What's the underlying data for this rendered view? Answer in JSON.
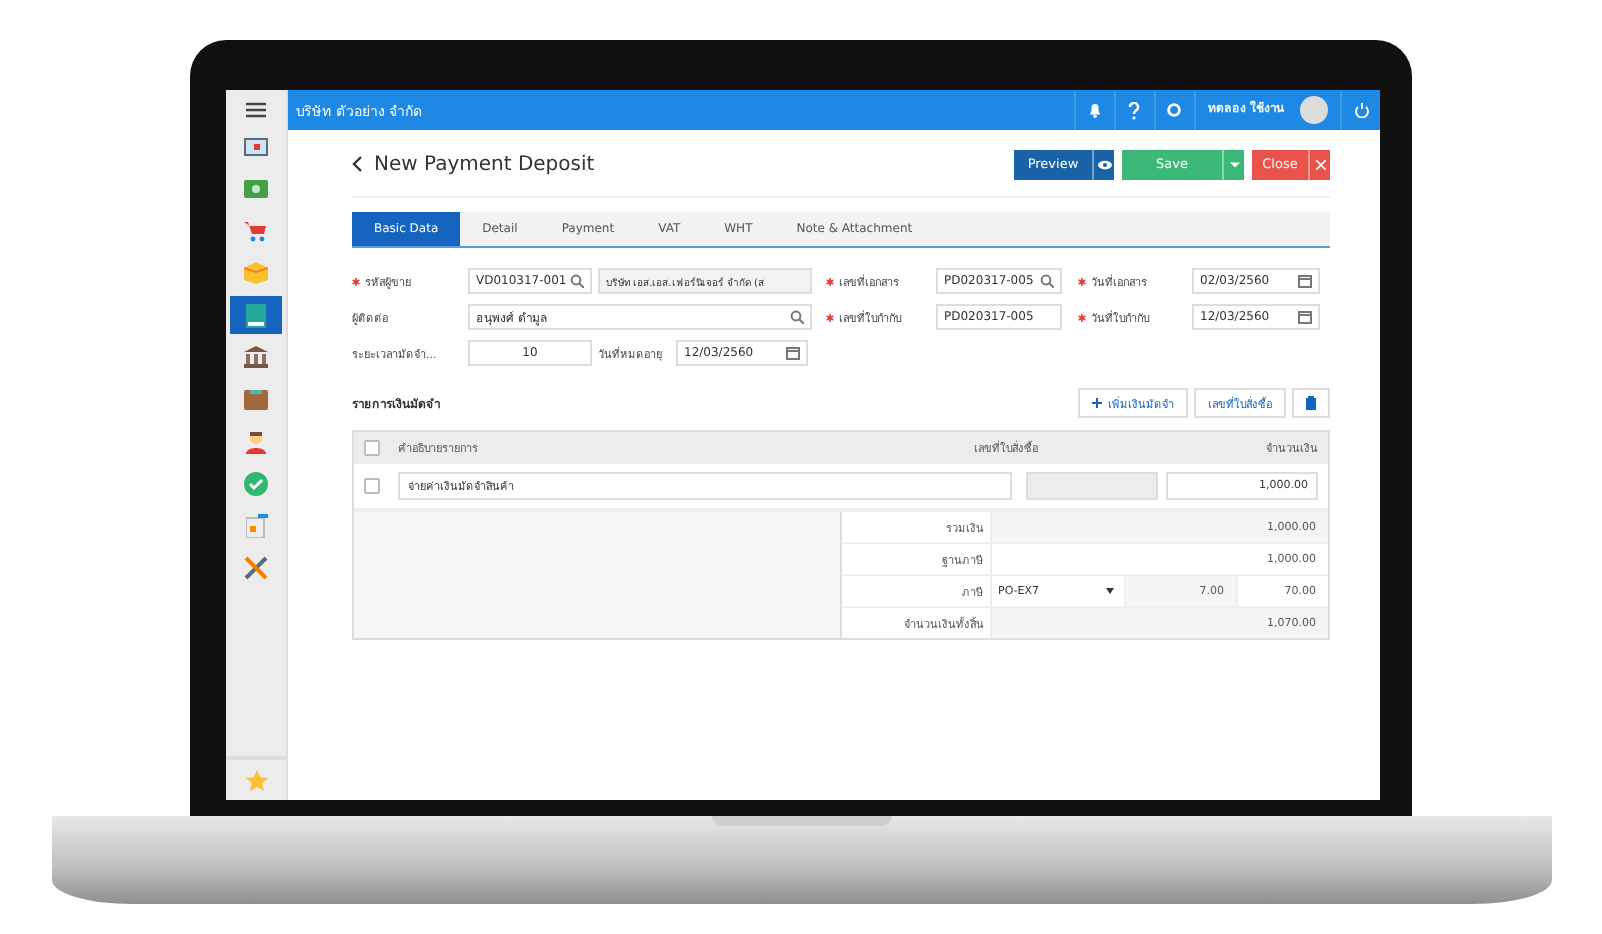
{
  "header": {
    "company": "บริษัท ตัวอย่าง จำกัด",
    "user": "ทดลอง ใช้งาน"
  },
  "sidebar": {
    "items": [
      {
        "selected": false
      },
      {
        "selected": false
      },
      {
        "selected": false
      },
      {
        "selected": false
      },
      {
        "selected": true
      },
      {
        "selected": false
      },
      {
        "selected": false
      },
      {
        "selected": false
      },
      {
        "selected": false
      },
      {
        "selected": false
      },
      {
        "selected": false
      }
    ]
  },
  "page": {
    "title": "New Payment Deposit"
  },
  "actions": [
    {
      "label": "Preview",
      "kind": "preview"
    },
    {
      "label": "Save",
      "kind": "save"
    },
    {
      "label": "Close",
      "kind": "close"
    }
  ],
  "tabs": [
    {
      "label": "Basic Data",
      "selected": true
    },
    {
      "label": "Detail",
      "selected": false
    },
    {
      "label": "Payment",
      "selected": false
    },
    {
      "label": "VAT",
      "selected": false
    },
    {
      "label": "WHT",
      "selected": false
    },
    {
      "label": "Note & Attachment",
      "selected": false
    }
  ],
  "form": {
    "vendor": {
      "label": "รหัสผู้ขาย",
      "required": true,
      "value": "VD010317-001",
      "name": "บริษัท เอส.เอส.เฟอร์นิเจอร์ จำกัด (ส"
    },
    "doc_no": {
      "label": "เลขที่เอกสาร",
      "required": true,
      "value": "PD020317-005"
    },
    "doc_date": {
      "label": "วันที่เอกสาร",
      "required": true,
      "value": "02/03/2560"
    },
    "contact": {
      "label": "ผู้ติดต่อ",
      "required": false,
      "value": "อนุพงศ์ ดำมูล"
    },
    "invoice_no": {
      "label": "เลขที่ใบกำกับ",
      "required": true,
      "value": "PD020317-005"
    },
    "invoice_date": {
      "label": "วันที่ใบกำกับ",
      "required": true,
      "value": "12/03/2560"
    },
    "deposit_days": {
      "label": "ระยะเวลามัดจำ...",
      "required": false,
      "value": "10"
    },
    "expiry": {
      "label": "วันที่หมดอายุ",
      "required": false,
      "value": "12/03/2560"
    }
  },
  "deposits": {
    "title": "รายการเงินมัดจำ",
    "add_button": "เพิ่มเงินมัดจำ",
    "po_button": "เลขที่ใบสั่งซื้อ",
    "columns": [
      "คำอธิบายรายการ",
      "เลขที่ใบสั่งซื้อ",
      "จำนวนเงิน"
    ],
    "rows": [
      {
        "checked": false,
        "description": "จ่ายค่าเงินมัดจำสินค้า",
        "amount": "1,000.00"
      }
    ],
    "header_checked": false,
    "summary": {
      "subtotal_label": "รวมเงิน",
      "subtotal": "1,000.00",
      "base_label": "ฐานภาษี",
      "base": "1,000.00",
      "tax_label": "ภาษี",
      "tax_code": "PO-EX7",
      "tax_rate": "7.00",
      "tax": "70.00",
      "total_label": "จำนวนเงินทั้งสิ้น",
      "total": "1,070.00"
    }
  }
}
